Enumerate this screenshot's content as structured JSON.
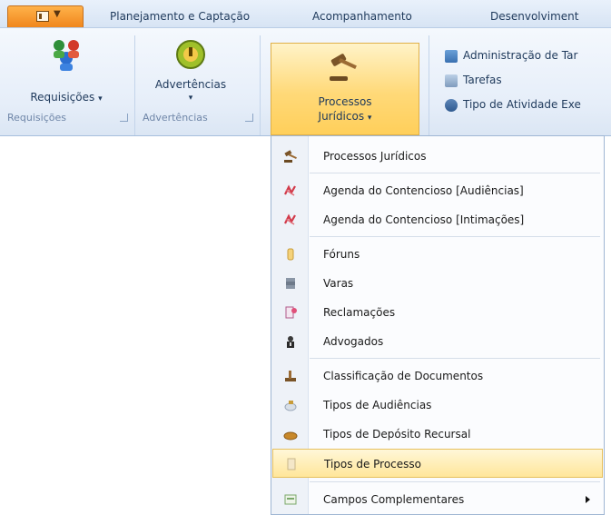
{
  "tabs": [
    {
      "label": "Planejamento e Captação"
    },
    {
      "label": "Acompanhamento"
    },
    {
      "label": "Desenvolviment"
    }
  ],
  "ribbon": {
    "requisicoes": {
      "label": "Requisições",
      "group": "Requisições"
    },
    "advertencias": {
      "label": "Advertências",
      "group": "Advertências"
    },
    "processos": {
      "line1": "Processos",
      "line2": "Jurídicos"
    },
    "small_items": [
      {
        "label": "Administração de Tar",
        "icon": "admin-icon"
      },
      {
        "label": "Tarefas",
        "icon": "tasks-icon"
      },
      {
        "label": "Tipo de Atividade Exe",
        "icon": "activity-type-icon"
      }
    ]
  },
  "menu": {
    "items": [
      {
        "label": "Processos Jurídicos",
        "icon": "gavel-icon"
      },
      {
        "label": "Agenda do Contencioso [Audiências]",
        "icon": "calendar-icon"
      },
      {
        "label": "Agenda do Contencioso [Intimações]",
        "icon": "calendar-icon"
      },
      {
        "label": "Fóruns",
        "icon": "column-icon"
      },
      {
        "label": "Varas",
        "icon": "stack-icon"
      },
      {
        "label": "Reclamações",
        "icon": "complaint-icon"
      },
      {
        "label": "Advogados",
        "icon": "lawyer-icon"
      },
      {
        "label": "Classificação de Documentos",
        "icon": "classification-icon"
      },
      {
        "label": "Tipos de Audiências",
        "icon": "hearing-icon"
      },
      {
        "label": "Tipos de Depósito Recursal",
        "icon": "deposit-icon"
      },
      {
        "label": "Tipos de Processo",
        "icon": "process-type-icon"
      },
      {
        "label": "Campos Complementares",
        "icon": "fields-icon"
      }
    ]
  },
  "colors": {
    "accent": "#f0861c",
    "highlight": "#ffe69a",
    "ribbon": "#e6eef9"
  }
}
